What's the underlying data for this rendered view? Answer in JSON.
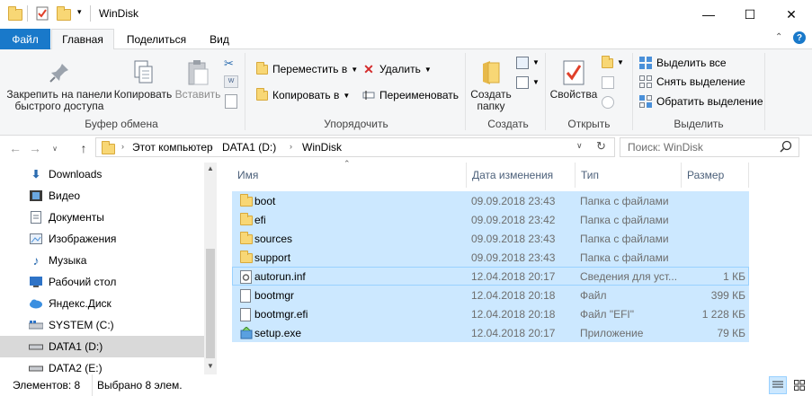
{
  "window": {
    "title": "WinDisk",
    "minimize_glyph": "—",
    "maximize_glyph": "☐",
    "close_glyph": "✕"
  },
  "tabs": {
    "file": "Файл",
    "home": "Главная",
    "share": "Поделиться",
    "view": "Вид"
  },
  "ribbon": {
    "clipboard": {
      "pin": "Закрепить на панели быстрого доступа",
      "pin_line1": "Закрепить на панели",
      "pin_line2": "быстрого доступа",
      "copy": "Копировать",
      "paste": "Вставить",
      "group": "Буфер обмена"
    },
    "organize": {
      "move": "Переместить в",
      "copy_to": "Копировать в",
      "delete": "Удалить",
      "rename": "Переименовать",
      "group": "Упорядочить"
    },
    "new": {
      "new_folder_line1": "Создать",
      "new_folder_line2": "папку",
      "group": "Создать"
    },
    "open": {
      "properties": "Свойства",
      "group": "Открыть"
    },
    "select": {
      "select_all": "Выделить все",
      "select_none": "Снять выделение",
      "invert": "Обратить выделение",
      "group": "Выделить"
    }
  },
  "address": {
    "crumbs": [
      "Этот компьютер",
      "DATA1 (D:)",
      "WinDisk"
    ],
    "search_placeholder": "Поиск: WinDisk"
  },
  "nav": [
    {
      "label": "Downloads",
      "icon": "download-icon"
    },
    {
      "label": "Видео",
      "icon": "video-icon"
    },
    {
      "label": "Документы",
      "icon": "documents-icon"
    },
    {
      "label": "Изображения",
      "icon": "pictures-icon"
    },
    {
      "label": "Музыка",
      "icon": "music-icon"
    },
    {
      "label": "Рабочий стол",
      "icon": "desktop-icon"
    },
    {
      "label": "Яндекс.Диск",
      "icon": "cloud-icon"
    },
    {
      "label": "SYSTEM (C:)",
      "icon": "drive-icon"
    },
    {
      "label": "DATA1 (D:)",
      "icon": "drive-icon",
      "selected": true
    },
    {
      "label": "DATA2 (E:)",
      "icon": "drive-icon"
    }
  ],
  "columns": {
    "name": "Имя",
    "date": "Дата изменения",
    "type": "Тип",
    "size": "Размер"
  },
  "files": [
    {
      "name": "boot",
      "date": "09.09.2018 23:43",
      "type": "Папка с файлами",
      "size": "",
      "icon": "folder-icon"
    },
    {
      "name": "efi",
      "date": "09.09.2018 23:42",
      "type": "Папка с файлами",
      "size": "",
      "icon": "folder-icon"
    },
    {
      "name": "sources",
      "date": "09.09.2018 23:43",
      "type": "Папка с файлами",
      "size": "",
      "icon": "folder-icon"
    },
    {
      "name": "support",
      "date": "09.09.2018 23:43",
      "type": "Папка с файлами",
      "size": "",
      "icon": "folder-icon"
    },
    {
      "name": "autorun.inf",
      "date": "12.04.2018 20:17",
      "type": "Сведения для уст...",
      "size": "1 КБ",
      "icon": "settings-file-icon"
    },
    {
      "name": "bootmgr",
      "date": "12.04.2018 20:18",
      "type": "Файл",
      "size": "399 КБ",
      "icon": "file-icon"
    },
    {
      "name": "bootmgr.efi",
      "date": "12.04.2018 20:18",
      "type": "Файл \"EFI\"",
      "size": "1 228 КБ",
      "icon": "file-icon"
    },
    {
      "name": "setup.exe",
      "date": "12.04.2018 20:17",
      "type": "Приложение",
      "size": "79 КБ",
      "icon": "setup-app-icon"
    }
  ],
  "status": {
    "items": "Элементов: 8",
    "selected": "Выбрано 8 элем."
  },
  "colors": {
    "accent": "#1979ca",
    "selection": "#cce8ff",
    "folder": "#f8d775"
  }
}
